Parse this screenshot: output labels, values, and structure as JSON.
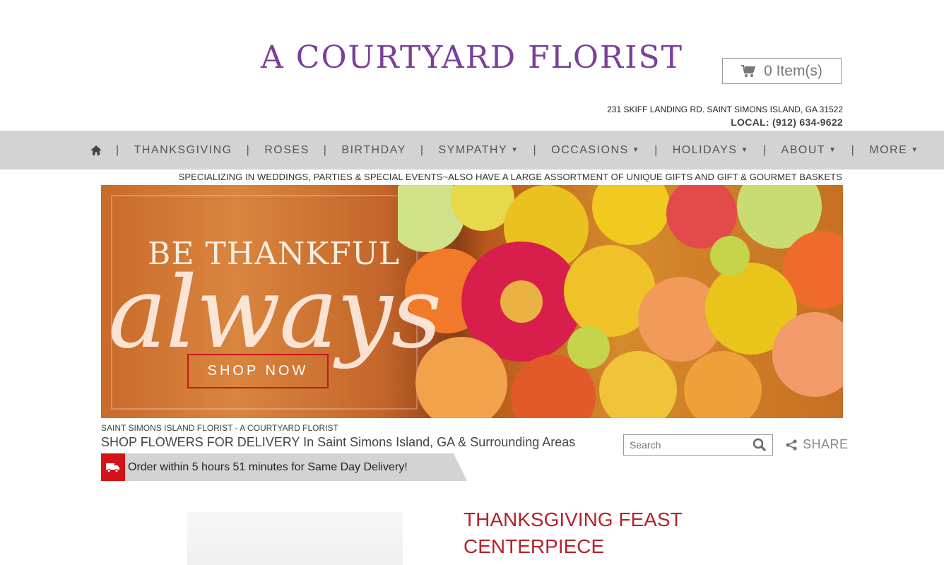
{
  "header": {
    "logo_text": "A COURTYARD FLORIST",
    "cart_label": "0 Item(s)",
    "address": "231 SKIFF LANDING RD. SAINT SIMONS ISLAND, GA 31522",
    "phone": "LOCAL: (912) 634-9622"
  },
  "nav": {
    "items": [
      {
        "label": "THANKSGIVING"
      },
      {
        "label": "ROSES"
      },
      {
        "label": "BIRTHDAY"
      },
      {
        "label": "SYMPATHY"
      },
      {
        "label": "OCCASIONS"
      },
      {
        "label": "HOLIDAYS"
      },
      {
        "label": "ABOUT"
      },
      {
        "label": "MORE"
      }
    ],
    "separator": "|"
  },
  "tagline": "SPECIALIZING IN WEDDINGS, PARTIES & SPECIAL EVENTS~ALSO HAVE A LARGE ASSORTMENT OF UNIQUE GIFTS AND GIFT & GOURMET BASKETS",
  "hero": {
    "line1": "BE THANKFUL",
    "line2": "always",
    "cta": "SHOP NOW"
  },
  "main": {
    "breadcrumb": "SAINT SIMONS ISLAND FLORIST - A COURTYARD FLORIST",
    "heading": "SHOP FLOWERS FOR DELIVERY In Saint Simons Island, GA & Surrounding Areas",
    "search_placeholder": "Search",
    "share_label": "SHARE",
    "delivery_text": "Order within 5 hours 51 minutes for Same Day Delivery!"
  },
  "product": {
    "title": "THANKSGIVING FEAST CENTERPIECE"
  },
  "colors": {
    "brand_purple": "#7b3f9b",
    "accent_red": "#d3131a",
    "nav_bg": "#d3d3d3"
  }
}
